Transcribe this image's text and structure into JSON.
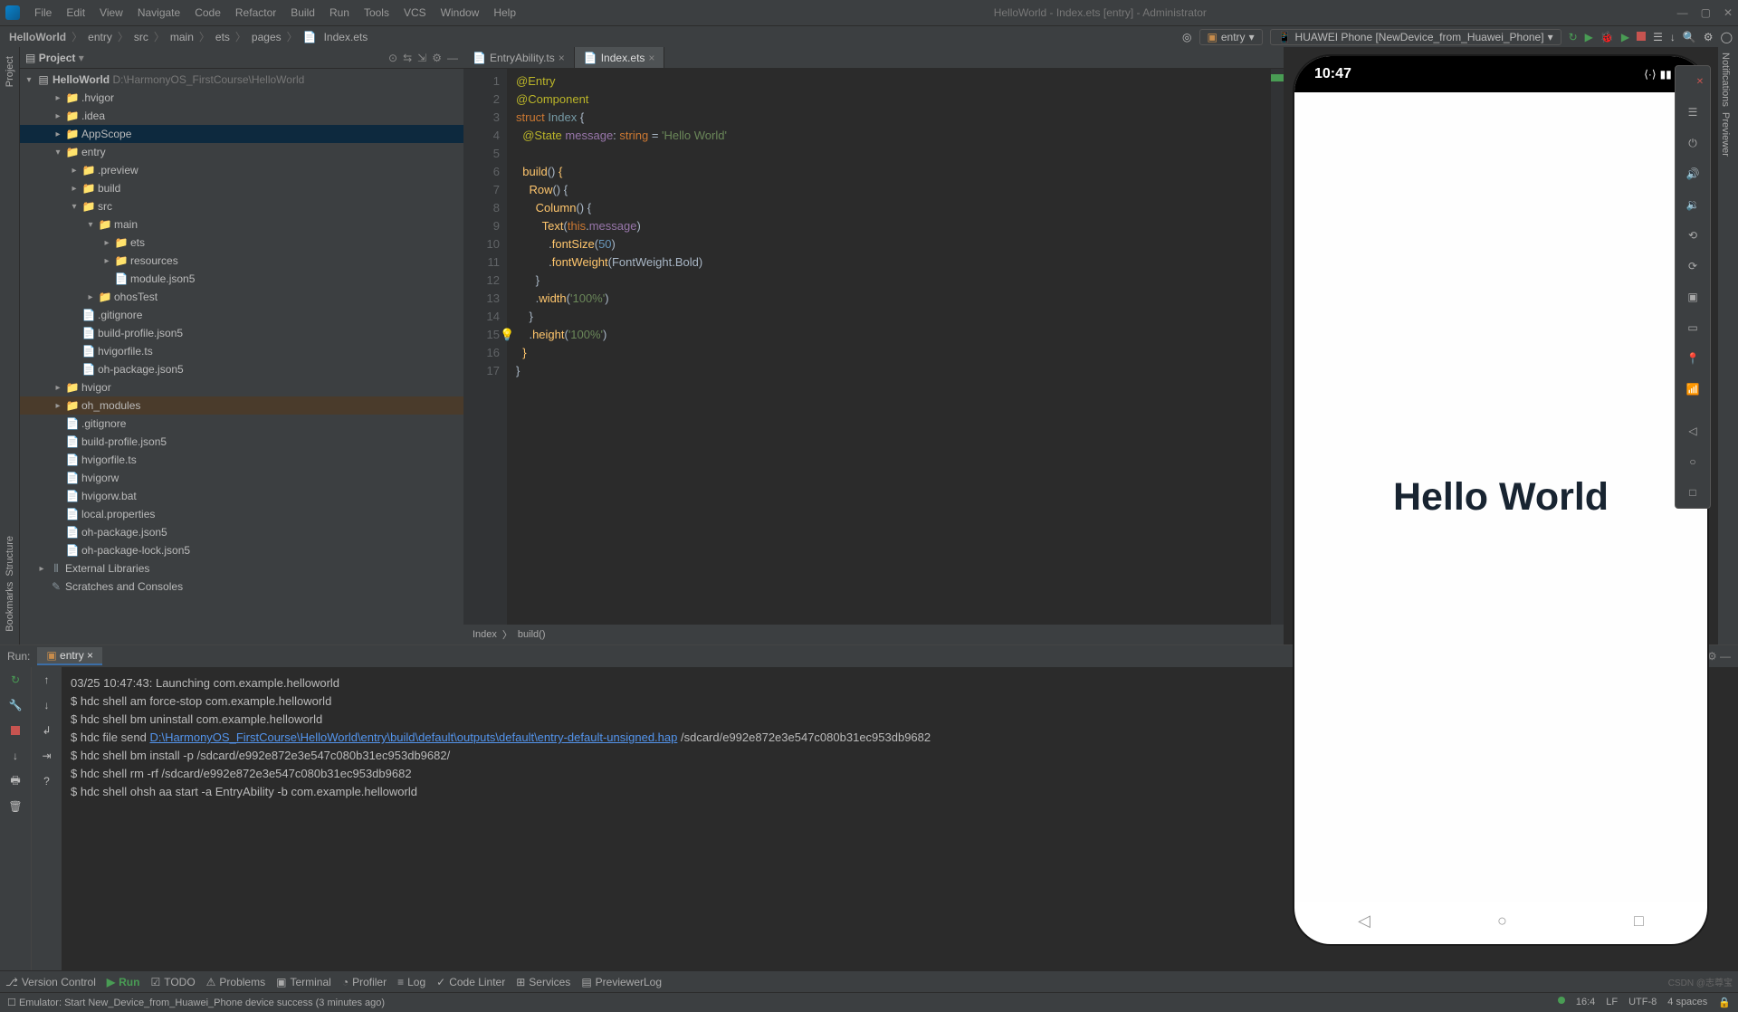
{
  "title": "HelloWorld - Index.ets [entry] - Administrator",
  "menu": [
    "File",
    "Edit",
    "View",
    "Navigate",
    "Code",
    "Refactor",
    "Build",
    "Run",
    "Tools",
    "VCS",
    "Window",
    "Help"
  ],
  "breadcrumbs": [
    "HelloWorld",
    "entry",
    "src",
    "main",
    "ets",
    "pages",
    "Index.ets"
  ],
  "run_config": "entry",
  "device": "HUAWEI Phone [NewDevice_from_Huawei_Phone]",
  "project_panel": "Project",
  "tree": {
    "root": {
      "name": "HelloWorld",
      "path": "D:\\HarmonyOS_FirstCourse\\HelloWorld"
    },
    "items": [
      {
        "l": 1,
        "name": ".hvigor",
        "t": "folder"
      },
      {
        "l": 1,
        "name": ".idea",
        "t": "folder"
      },
      {
        "l": 1,
        "name": "AppScope",
        "t": "folder",
        "sel": true
      },
      {
        "l": 1,
        "name": "entry",
        "t": "entry",
        "open": true
      },
      {
        "l": 2,
        "name": ".preview",
        "t": "folder"
      },
      {
        "l": 2,
        "name": "build",
        "t": "build"
      },
      {
        "l": 2,
        "name": "src",
        "t": "src",
        "open": true
      },
      {
        "l": 3,
        "name": "main",
        "t": "folder",
        "open": true
      },
      {
        "l": 4,
        "name": "ets",
        "t": "folder"
      },
      {
        "l": 4,
        "name": "resources",
        "t": "folder"
      },
      {
        "l": 4,
        "name": "module.json5",
        "t": "file"
      },
      {
        "l": 3,
        "name": "ohosTest",
        "t": "folder"
      },
      {
        "l": 2,
        "name": ".gitignore",
        "t": "file"
      },
      {
        "l": 2,
        "name": "build-profile.json5",
        "t": "file"
      },
      {
        "l": 2,
        "name": "hvigorfile.ts",
        "t": "file"
      },
      {
        "l": 2,
        "name": "oh-package.json5",
        "t": "file"
      },
      {
        "l": 1,
        "name": "hvigor",
        "t": "folder"
      },
      {
        "l": 1,
        "name": "oh_modules",
        "t": "entry",
        "shade": true
      },
      {
        "l": 1,
        "name": ".gitignore",
        "t": "file"
      },
      {
        "l": 1,
        "name": "build-profile.json5",
        "t": "file"
      },
      {
        "l": 1,
        "name": "hvigorfile.ts",
        "t": "file"
      },
      {
        "l": 1,
        "name": "hvigorw",
        "t": "file"
      },
      {
        "l": 1,
        "name": "hvigorw.bat",
        "t": "file"
      },
      {
        "l": 1,
        "name": "local.properties",
        "t": "file"
      },
      {
        "l": 1,
        "name": "oh-package.json5",
        "t": "file"
      },
      {
        "l": 1,
        "name": "oh-package-lock.json5",
        "t": "file"
      },
      {
        "l": 0,
        "name": "External Libraries",
        "t": "lib"
      },
      {
        "l": 0,
        "name": "Scratches and Consoles",
        "t": "scratch"
      }
    ]
  },
  "tabs": [
    {
      "name": "EntryAbility.ts",
      "active": false
    },
    {
      "name": "Index.ets",
      "active": true
    }
  ],
  "code_lines": [
    1,
    2,
    3,
    4,
    5,
    6,
    7,
    8,
    9,
    10,
    11,
    12,
    13,
    14,
    15,
    16,
    17
  ],
  "bread2": [
    "Index",
    "build()"
  ],
  "phone": {
    "time": "10:47",
    "hello": "Hello World"
  },
  "run_tab_label": "Run:",
  "run_tab": "entry",
  "console": {
    "l1": "03/25 10:47:43: Launching com.example.helloworld",
    "l2": "$ hdc shell am force-stop com.example.helloworld",
    "l3": "$ hdc shell bm uninstall com.example.helloworld",
    "l4a": "$ hdc file send ",
    "l4b": "D:\\HarmonyOS_FirstCourse\\HelloWorld\\entry\\build\\default\\outputs\\default\\entry-default-unsigned.hap",
    "l4c": " /sdcard/e992e872e3e547c080b31ec953db9682",
    "l5": "$ hdc shell bm install -p /sdcard/e992e872e3e547c080b31ec953db9682/",
    "l6": "$ hdc shell rm -rf /sdcard/e992e872e3e547c080b31ec953db9682",
    "l7": "$ hdc shell ohsh aa start -a EntryAbility -b com.example.helloworld"
  },
  "bottom": [
    "Version Control",
    "Run",
    "TODO",
    "Problems",
    "Terminal",
    "Profiler",
    "Log",
    "Code Linter",
    "Services",
    "PreviewerLog"
  ],
  "status": {
    "msg": "Emulator: Start New_Device_from_Huawei_Phone device success (3 minutes ago)",
    "pos": "16:4",
    "lf": "LF",
    "enc": "UTF-8",
    "ind": "4 spaces"
  },
  "watermark": "CSDN @志尊宝"
}
